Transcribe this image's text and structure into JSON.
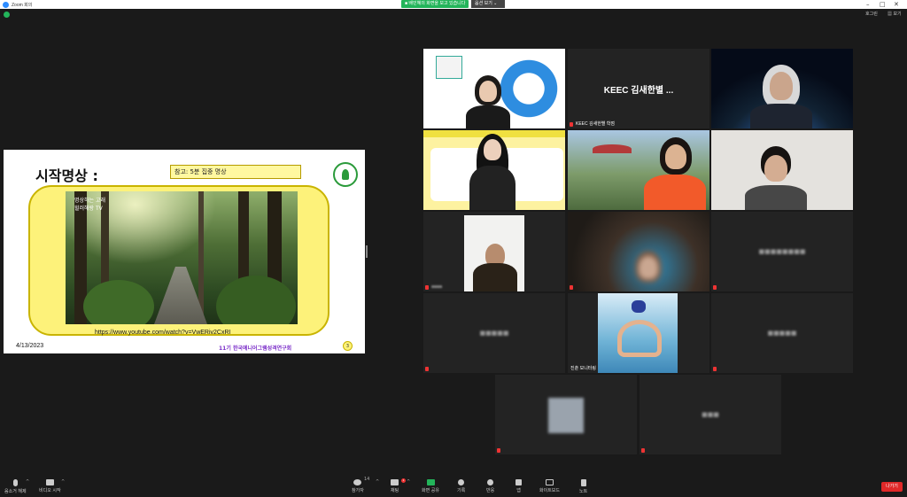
{
  "window": {
    "title": "Zoom 회의",
    "sharing_notice": "■ 배민혜의 화면을 보고 있습니다",
    "view_option": "옵션 보기",
    "minimize": "–",
    "maximize": "□",
    "close": "✕"
  },
  "top_right": {
    "speaker_view": "호그린",
    "view": "보기"
  },
  "slide": {
    "title": "시작명상 :",
    "reference": "참고: 5분 집중 명상",
    "video_caption_1": "명상하는 고래",
    "video_caption_2": "힐러해랑 TV",
    "url": "https://www.youtube.com/watch?v=VwERiv2CxRI",
    "date": "4/13/2023",
    "footer": "11기 한국에니어그램성격연구회",
    "page": "3"
  },
  "gallery": {
    "tiles": [
      {
        "name": ""
      },
      {
        "name": "KEEC 김새한별 ...",
        "label": "KEEC 김새한별 학점"
      },
      {
        "name": ""
      },
      {
        "name": ""
      },
      {
        "name": ""
      },
      {
        "name": ""
      },
      {
        "name": ""
      },
      {
        "name": ""
      },
      {
        "name": ""
      },
      {
        "name": "",
        "label": "진춘 모니터링"
      }
    ]
  },
  "toolbar": {
    "mute": "음소거 해제",
    "video": "비디오 시작",
    "participants": "참가자",
    "participants_count": "14",
    "chat": "채팅",
    "chat_badge": "1",
    "share": "화면 공유",
    "record": "기록",
    "reactions": "반응",
    "apps": "앱",
    "whiteboard": "화이트보드",
    "notes": "노트",
    "leave": "나가기"
  }
}
